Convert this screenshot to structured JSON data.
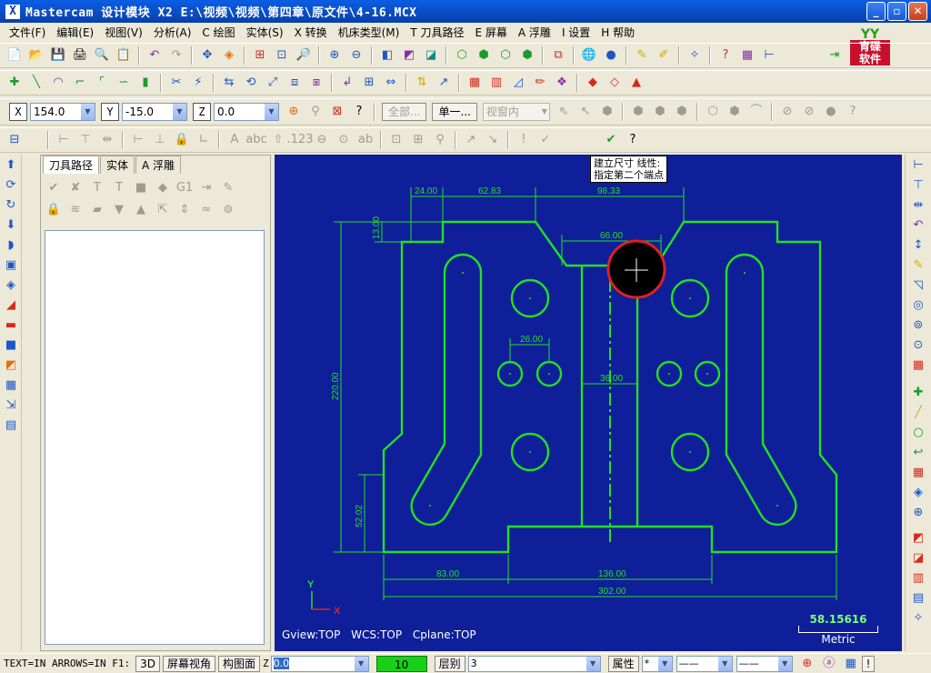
{
  "window": {
    "title": "Mastercam 设计模块  X2  E:\\视频\\视频\\第四章\\原文件\\4-16.MCX",
    "app_icon": "X"
  },
  "menu": [
    "文件(F)",
    "编辑(E)",
    "视图(V)",
    "分析(A)",
    "C 绘图",
    "实体(S)",
    "X 转换",
    "机床类型(M)",
    "T 刀具路径",
    "E 屏幕",
    "A 浮雕",
    "I 设置",
    "H 帮助"
  ],
  "logo": {
    "top": "YY",
    "line1": "育碟",
    "line2": "软件"
  },
  "coords": {
    "x_label": "X",
    "x_value": "154.0",
    "y_label": "Y",
    "y_value": "-15.0",
    "z_label": "Z",
    "z_value": "0.0",
    "all_button": "全部...",
    "single_button": "单一...",
    "view_select": "视窗内"
  },
  "manager": {
    "tabs": [
      "刀具路径",
      "实体",
      "A 浮雕"
    ]
  },
  "viewport": {
    "tooltip_line1": "建立尺寸 线性:",
    "tooltip_line2": "指定第二个端点",
    "gview": "Gview:TOP",
    "wcs": "WCS:TOP",
    "cplane": "Cplane:TOP",
    "scale_value": "58.15616",
    "scale_unit": "Metric",
    "axis_y": "Y",
    "axis_x": "X",
    "dimensions": {
      "d2400": "24.00",
      "d6283": "62.83",
      "d9833": "98.33",
      "d1300": "13.00",
      "d6600": "66.00",
      "d2200": "220.00",
      "d2600": "26.00",
      "d3600": "36.00",
      "d5202": "52.02",
      "d8300": "83.00",
      "d13600": "136.00",
      "d30200": "302.00"
    },
    "colors": {
      "background": "#0e1f99",
      "geometry": "#22e022",
      "highlight": "#e02020"
    }
  },
  "status": {
    "text": "TEXT=IN ARROWS=IN F1:",
    "btn_3d": "3D",
    "btn_screen_view": "屏幕视角",
    "btn_plane": "构图面",
    "z_label": "Z",
    "z_value": "0.0",
    "color_value": "10",
    "level_label": "层别",
    "level_value": "3",
    "attr_label": "属性",
    "point_style": "*",
    "help": "!"
  }
}
